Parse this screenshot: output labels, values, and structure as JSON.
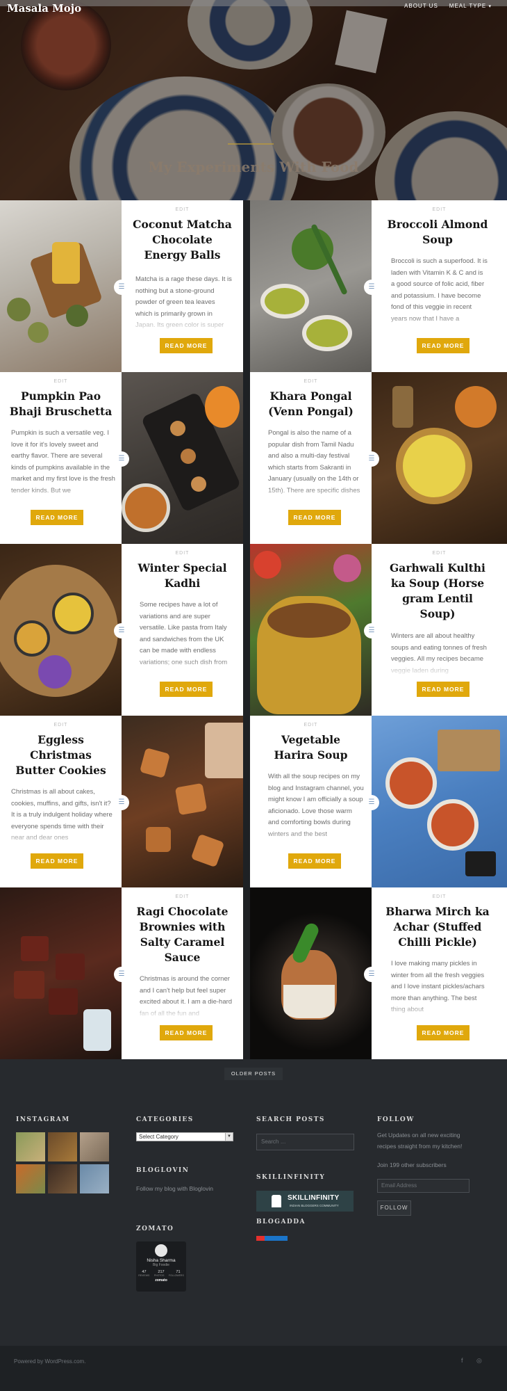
{
  "site": {
    "title": "Masala Mojo",
    "tagline": "My Experiments With Food"
  },
  "nav": {
    "items": [
      "ABOUT US",
      "MEAL TYPE"
    ],
    "caret": "▾"
  },
  "posts": [
    {
      "edit": "EDIT",
      "title": "Coconut Matcha Chocolate Energy Balls",
      "excerpt": "Matcha is a rage these days. It is nothing but a stone-ground powder of green tea leaves which is primarily grown in Japan. Its green color is super",
      "button": "READ MORE"
    },
    {
      "edit": "EDIT",
      "title": "Broccoli Almond Soup",
      "excerpt": "Broccoli is such a superfood. It is laden with Vitamin K & C and is a good source of folic acid, fiber and potassium. I have become fond of this veggie in recent years now that I have a",
      "button": "READ MORE"
    },
    {
      "edit": "EDIT",
      "title": "Pumpkin Pao Bhaji Bruschetta",
      "excerpt": "Pumpkin is such a versatile veg. I love it for it's lovely sweet and earthy flavor. There are several kinds of pumpkins available in the market and my first love is the fresh tender kinds. But we",
      "button": "READ MORE"
    },
    {
      "edit": "EDIT",
      "title": "Khara Pongal (Venn Pongal)",
      "excerpt": "Pongal is also the name of a popular dish from Tamil Nadu and also a multi-day festival which starts from Sakranti in January (usually on the 14th or 15th). There are specific dishes",
      "button": "READ MORE"
    },
    {
      "edit": "EDIT",
      "title": "Winter Special Kadhi",
      "excerpt": "Some recipes have a lot of variations and are super versatile. Like pasta from Italy and sandwiches from the UK can be made with endless variations; one such dish from",
      "button": "READ MORE"
    },
    {
      "edit": "EDIT",
      "title": "Garhwali Kulthi ka Soup (Horse gram Lentil Soup)",
      "excerpt": "Winters are all about healthy soups and eating tonnes of fresh veggies. All my recipes became veggie laden during",
      "button": "READ MORE"
    },
    {
      "edit": "EDIT",
      "title": "Eggless Christmas Butter Cookies",
      "excerpt": "Christmas is all about cakes, cookies, muffins, and gifts, isn't it? It is a truly indulgent holiday where everyone spends time with their near and dear ones",
      "button": "READ MORE"
    },
    {
      "edit": "EDIT",
      "title": "Vegetable Harira Soup",
      "excerpt": "With all the soup recipes on my blog and Instagram channel, you might know I am officially a soup aficionado. Love those warm and comforting bowls during winters and the best",
      "button": "READ MORE"
    },
    {
      "edit": "EDIT",
      "title": "Ragi Chocolate Brownies with Salty Caramel Sauce",
      "excerpt": "Christmas is around the corner and I can't help but feel super excited about it. I am a die-hard fan of all the fun and",
      "button": "READ MORE"
    },
    {
      "edit": "EDIT",
      "title": "Bharwa Mirch ka Achar (Stuffed Chilli Pickle)",
      "excerpt": "I love making many pickles in winter from all the fresh veggies and I love instant pickles/achars more than anything. The best thing about",
      "button": "READ MORE"
    }
  ],
  "pagination": {
    "older": "OLDER POSTS"
  },
  "footer": {
    "instagram": {
      "title": "INSTAGRAM"
    },
    "categories": {
      "title": "CATEGORIES",
      "select": "Select Category"
    },
    "bloglovin": {
      "title": "BLOGLOVIN",
      "text": "Follow my blog with Bloglovin"
    },
    "zomato": {
      "title": "ZOMATO",
      "name": "Nisha Sharma",
      "badge": "Big Foodie",
      "stats": [
        "47",
        "217",
        "71"
      ],
      "stat_labels": [
        "REVIEWS",
        "PHOTOS",
        "FOLLOWERS"
      ],
      "brand": "zomato"
    },
    "search": {
      "title": "SEARCH POSTS",
      "placeholder": "Search …"
    },
    "skillinfinity": {
      "title": "SKILLINFINITY",
      "name": "SKILLINFINITY",
      "sub": "INDIAN BLOGGERS COMMUNITY"
    },
    "blogadda": {
      "title": "BLOGADDA"
    },
    "follow": {
      "title": "FOLLOW",
      "text": "Get Updates on all new exciting recipes straight from my kitchen!",
      "subscribers": "Join 199 other subscribers",
      "email_placeholder": "Email Address",
      "button": "FOLLOW"
    },
    "powered": "Powered by WordPress.com.",
    "social_icons": [
      "facebook-icon",
      "instagram-icon"
    ]
  },
  "colors": {
    "accent": "#e0a80c",
    "footer": "#272a2e",
    "format_icon": "#7c9bbf"
  }
}
